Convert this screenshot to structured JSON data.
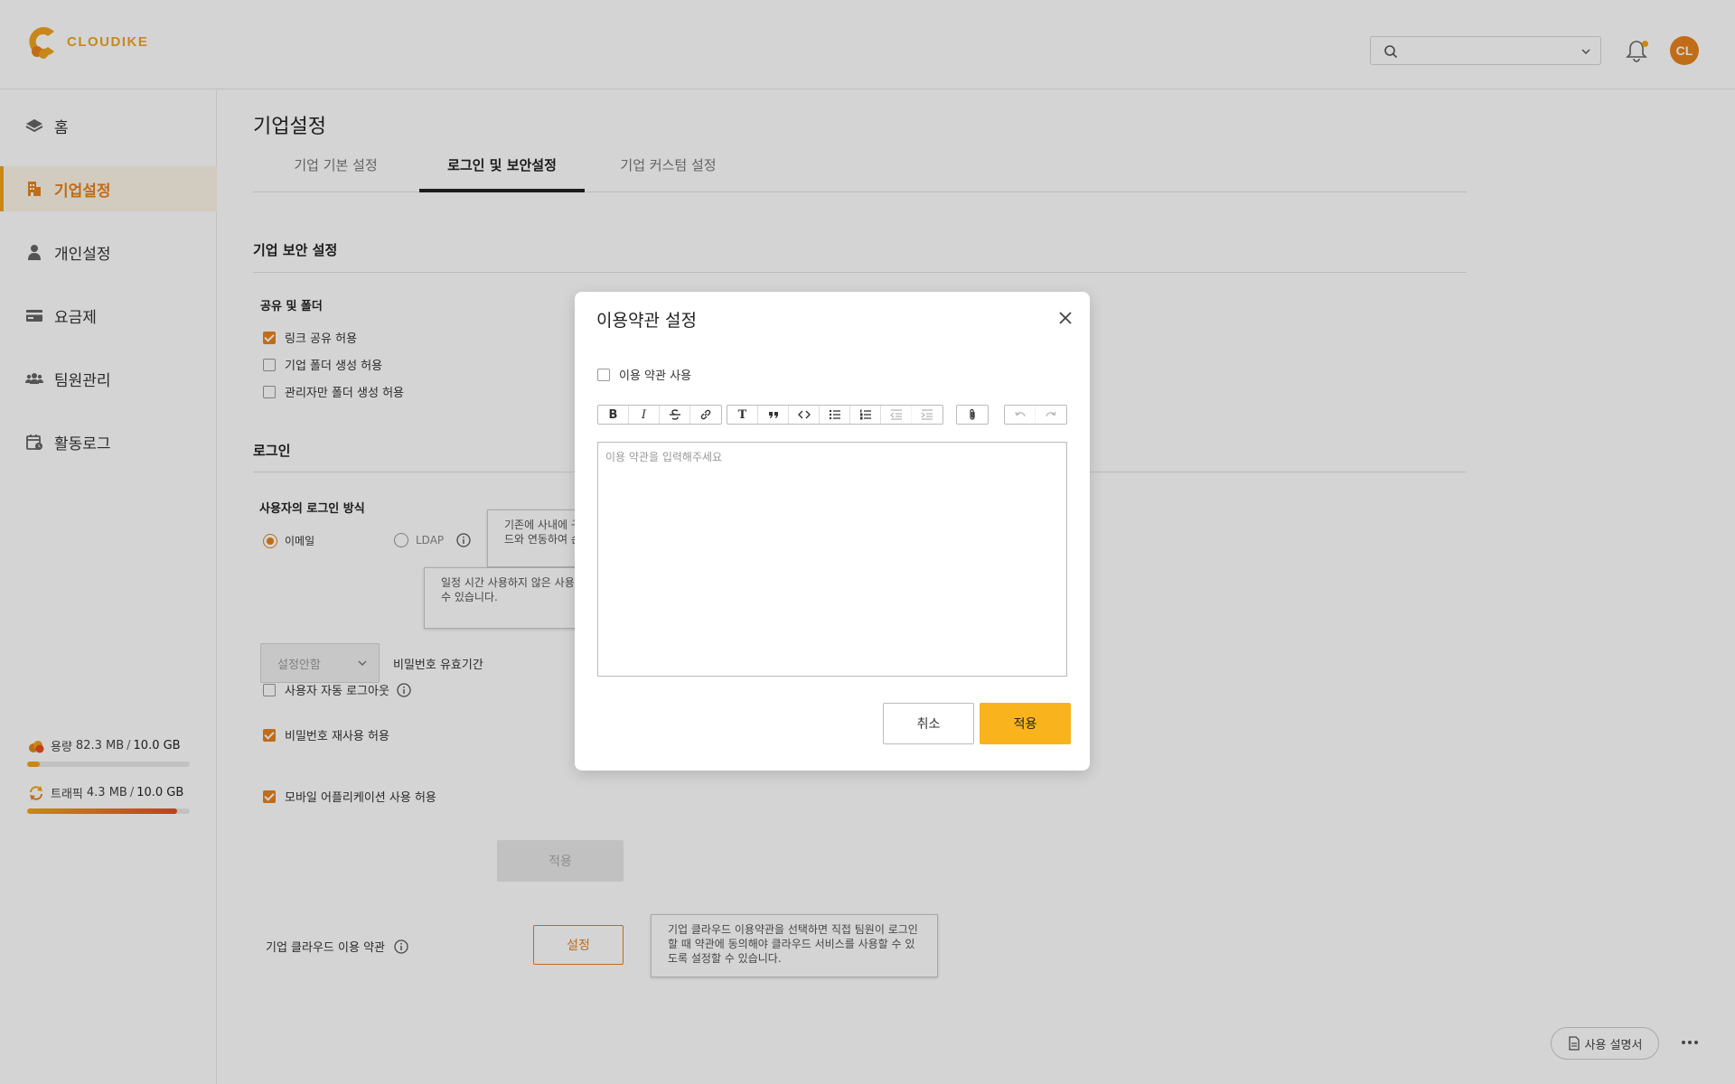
{
  "brand": {
    "name": "CLOUDIKE",
    "accent": "#e8821c",
    "yellow": "#f9b31c"
  },
  "header": {
    "search": {
      "value": "",
      "placeholder": ""
    },
    "user_initials": "CL"
  },
  "sidebar": {
    "items": [
      {
        "label": "홈",
        "icon": "layers-icon"
      },
      {
        "label": "기업설정",
        "icon": "building-icon",
        "active": true
      },
      {
        "label": "개인설정",
        "icon": "person-icon"
      },
      {
        "label": "요금제",
        "icon": "credit-card-icon"
      },
      {
        "label": "팀원관리",
        "icon": "team-icon"
      },
      {
        "label": "활동로그",
        "icon": "calendar-icon"
      }
    ],
    "storage": {
      "label": "용량",
      "used": "82.3 MB",
      "total": "10.0 GB",
      "fill_fraction": 0.08
    },
    "traffic": {
      "label": "트래픽",
      "used": "4.3 MB",
      "total": "10.0 GB",
      "fill_fraction": 0.92
    }
  },
  "main": {
    "page_title": "기업설정",
    "tabs": [
      {
        "label": "기업 기본 설정"
      },
      {
        "label": "로그인 및 보안설정",
        "active": true
      },
      {
        "label": "기업 커스텀 설정"
      }
    ],
    "security": {
      "title": "기업 보안 설정",
      "sharing_title": "공유 및 폴더",
      "options": [
        {
          "label": "링크 공유 허용",
          "checked": true
        },
        {
          "label": "기업 폴더 생성 허용",
          "checked": false
        },
        {
          "label": "관리자만 폴더 생성 허용",
          "checked": false
        }
      ]
    },
    "login": {
      "title": "로그인",
      "method_title": "사용자의 로그인 방식",
      "method_email": "이메일",
      "method_ldap": "LDAP",
      "ldap_tooltip": "기존에 사내에 구축된 LDAP 서버가 있을 경우, 기업 클라우드와 연동하여 손쉽게",
      "auto_logout_label": "사용자 자동 로그아웃",
      "auto_logout_tooltip": "일정 시간 사용하지 않은 사용자를 자동으로 로그아웃 되도록 설정할 수 있습니다.",
      "password_select": "설정안함",
      "password_label": "비밀번호 유효기간",
      "password_reuse_label": "비밀번호 재사용 허용",
      "mobile_app_label": "모바일 어플리케이션 사용 허용",
      "apply_label": "적용"
    },
    "terms": {
      "label": "기업 클라우드 이용 약관",
      "button": "설정",
      "tooltip": "기업 클라우드 이용약관을 선택하면 직접 팀원이 로그인할 때 약관에 동의해야 클라우드 서비스를 사용할 수 있도록 설정할 수 있습니다."
    },
    "manual_label": "사용 설명서"
  },
  "modal": {
    "title": "이용약관 설정",
    "use_terms_label": "이용 약관 사용",
    "use_terms_checked": false,
    "editor_placeholder": "이용 약관을 입력해주세요",
    "editor_value": "",
    "toolbar": {
      "bold": "B",
      "italic": "I",
      "heading": "T"
    },
    "cancel_label": "취소",
    "apply_label": "적용"
  }
}
